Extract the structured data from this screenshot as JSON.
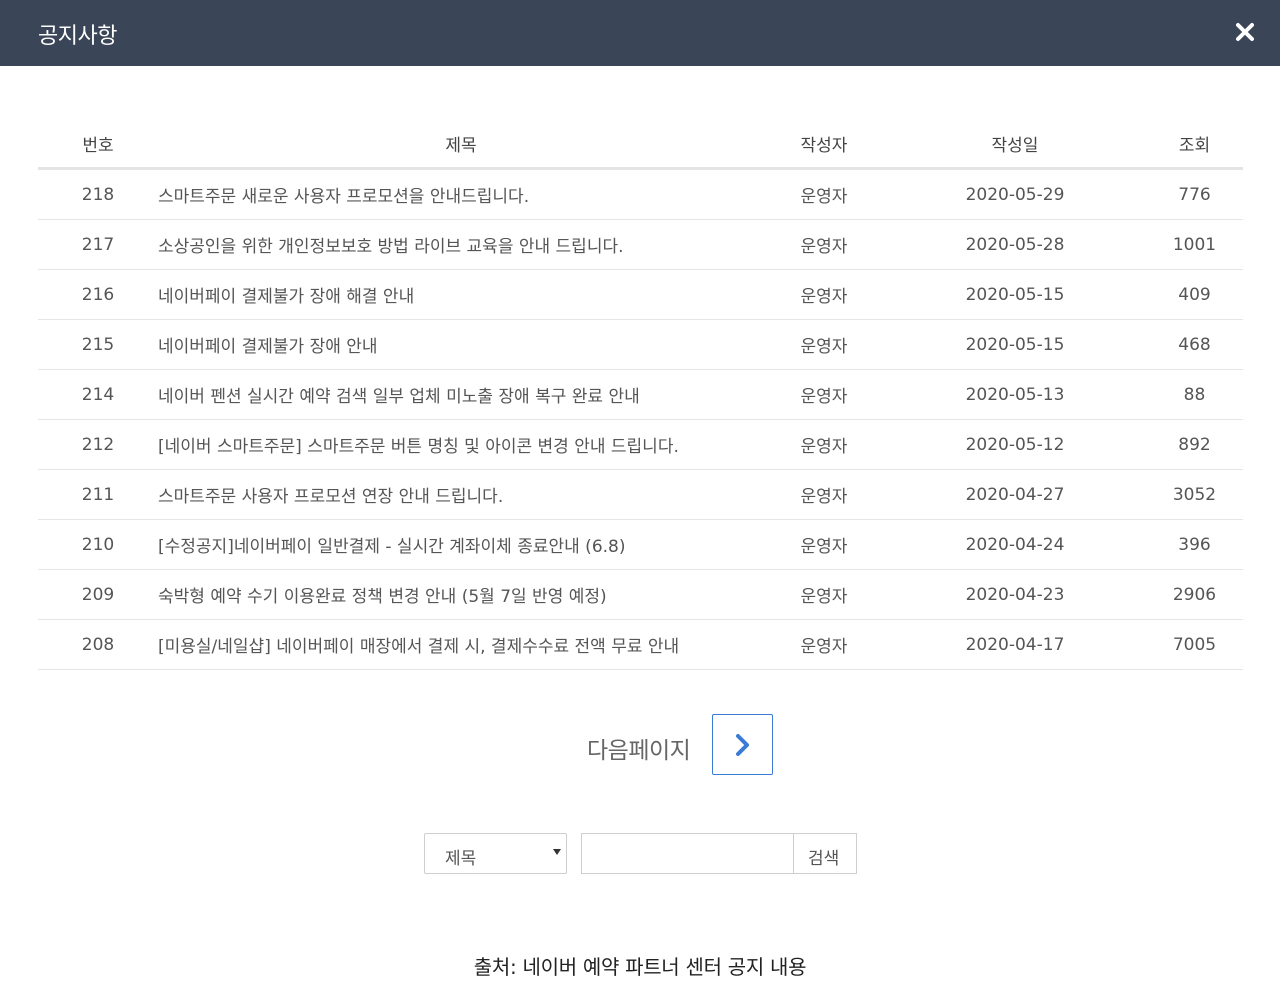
{
  "modal": {
    "title": "공지사항"
  },
  "colors": {
    "header_bg": "#3a4558",
    "pager_border": "#3a7bd5"
  },
  "icons": {
    "close": "close-icon",
    "next": "chevron-right-icon",
    "select_arrow": "caret-down-icon"
  },
  "table": {
    "headers": {
      "no": "번호",
      "title": "제목",
      "author": "작성자",
      "date": "작성일",
      "views": "조회"
    },
    "rows": [
      {
        "no": "218",
        "title": "스마트주문 새로운 사용자 프로모션을 안내드립니다.",
        "author": "운영자",
        "date": "2020-05-29",
        "views": "776"
      },
      {
        "no": "217",
        "title": "소상공인을 위한 개인정보보호 방법 라이브 교육을 안내 드립니다.",
        "author": "운영자",
        "date": "2020-05-28",
        "views": "1001"
      },
      {
        "no": "216",
        "title": "네이버페이 결제불가 장애 해결 안내",
        "author": "운영자",
        "date": "2020-05-15",
        "views": "409"
      },
      {
        "no": "215",
        "title": "네이버페이 결제불가 장애 안내",
        "author": "운영자",
        "date": "2020-05-15",
        "views": "468"
      },
      {
        "no": "214",
        "title": "네이버 펜션 실시간 예약 검색 일부 업체 미노출 장애 복구 완료 안내",
        "author": "운영자",
        "date": "2020-05-13",
        "views": "88"
      },
      {
        "no": "212",
        "title": "[네이버 스마트주문] 스마트주문 버튼 명칭 및 아이콘 변경 안내 드립니다.",
        "author": "운영자",
        "date": "2020-05-12",
        "views": "892"
      },
      {
        "no": "211",
        "title": "스마트주문 사용자 프로모션 연장 안내 드립니다.",
        "author": "운영자",
        "date": "2020-04-27",
        "views": "3052"
      },
      {
        "no": "210",
        "title": "[수정공지]네이버페이 일반결제 - 실시간 계좌이체 종료안내 (6.8)",
        "author": "운영자",
        "date": "2020-04-24",
        "views": "396"
      },
      {
        "no": "209",
        "title": "숙박형 예약 수기 이용완료 정책 변경 안내 (5월 7일 반영 예정)",
        "author": "운영자",
        "date": "2020-04-23",
        "views": "2906"
      },
      {
        "no": "208",
        "title": "[미용실/네일샵] 네이버페이 매장에서 결제 시, 결제수수료 전액 무료 안내",
        "author": "운영자",
        "date": "2020-04-17",
        "views": "7005"
      }
    ]
  },
  "pager": {
    "label": "다음페이지"
  },
  "search": {
    "select_value": "제목",
    "input_value": "",
    "button_label": "검색"
  },
  "caption": "출처: 네이버 예약 파트너 센터 공지 내용"
}
